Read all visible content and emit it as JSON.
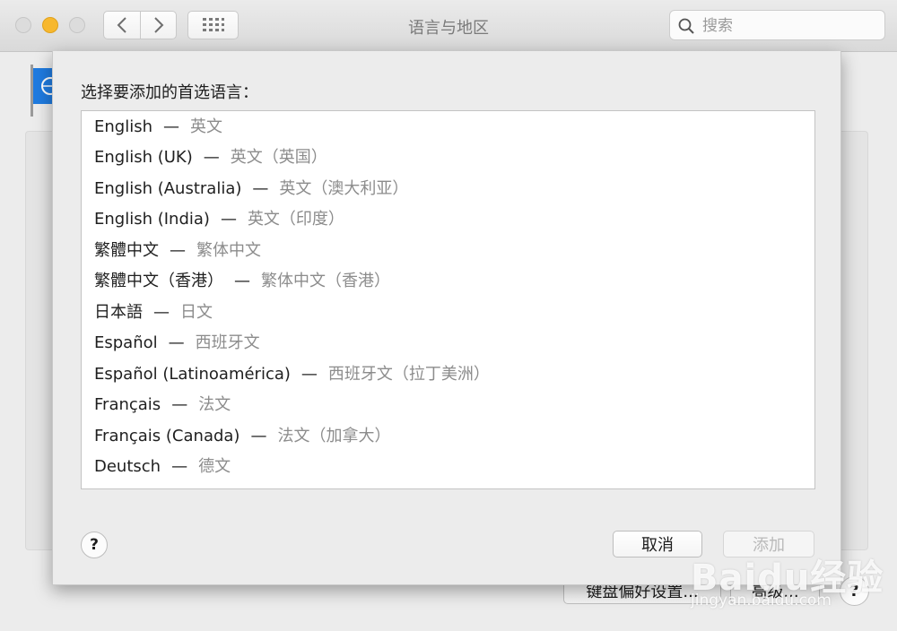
{
  "window": {
    "title": "语言与地区",
    "search_placeholder": "搜索"
  },
  "sheet": {
    "title": "选择要添加的首选语言：",
    "languages": [
      {
        "native": "English",
        "chinese": "英文"
      },
      {
        "native": "English (UK)",
        "chinese": "英文（英国）"
      },
      {
        "native": "English (Australia)",
        "chinese": "英文（澳大利亚）"
      },
      {
        "native": "English (India)",
        "chinese": "英文（印度）"
      },
      {
        "native": "繁體中文",
        "chinese": "繁体中文"
      },
      {
        "native": "繁體中文（香港）",
        "chinese": "繁体中文（香港）"
      },
      {
        "native": "日本語",
        "chinese": "日文"
      },
      {
        "native": "Español",
        "chinese": "西班牙文"
      },
      {
        "native": "Español (Latinoamérica)",
        "chinese": "西班牙文（拉丁美洲）"
      },
      {
        "native": "Français",
        "chinese": "法文"
      },
      {
        "native": "Français (Canada)",
        "chinese": "法文（加拿大）"
      },
      {
        "native": "Deutsch",
        "chinese": "德文"
      }
    ],
    "dash": "—",
    "help_label": "?",
    "cancel_label": "取消",
    "add_label": "添加"
  },
  "background": {
    "keyboard_button": "键盘偏好设置...",
    "advanced_button": "高级...",
    "help_label": "?"
  },
  "watermark": {
    "brand": "Baidu经验",
    "url": "jingyan.baidu.com"
  },
  "colors": {
    "traffic_minimize": "#f7b82f",
    "flag_blue": "#1f7be0"
  }
}
